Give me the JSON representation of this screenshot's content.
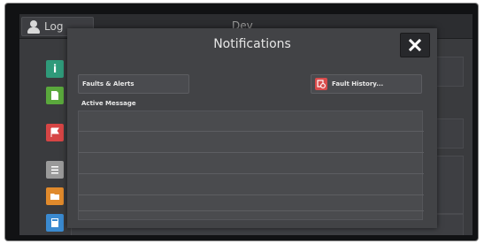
{
  "background": {
    "login_label": "Log",
    "device_label": "Dev"
  },
  "modal": {
    "title": "Notifications",
    "close_icon": "close-x-icon",
    "faults_button_label": "Faults & Alerts",
    "history_button_label": "Fault History...",
    "history_icon": "fault-history-icon",
    "active_message_label": "Active Message",
    "message_lines": [
      "",
      "",
      "",
      "",
      "",
      ""
    ]
  },
  "colors": {
    "info_tile": "#2f9a7a",
    "doc_tile": "#5aa83c",
    "flag_tile": "#d64545",
    "list_tile": "#9a9a9a",
    "folder_tile": "#e08a2c",
    "calc_tile": "#3a8ad0",
    "history_icon": "#d94b4b"
  }
}
